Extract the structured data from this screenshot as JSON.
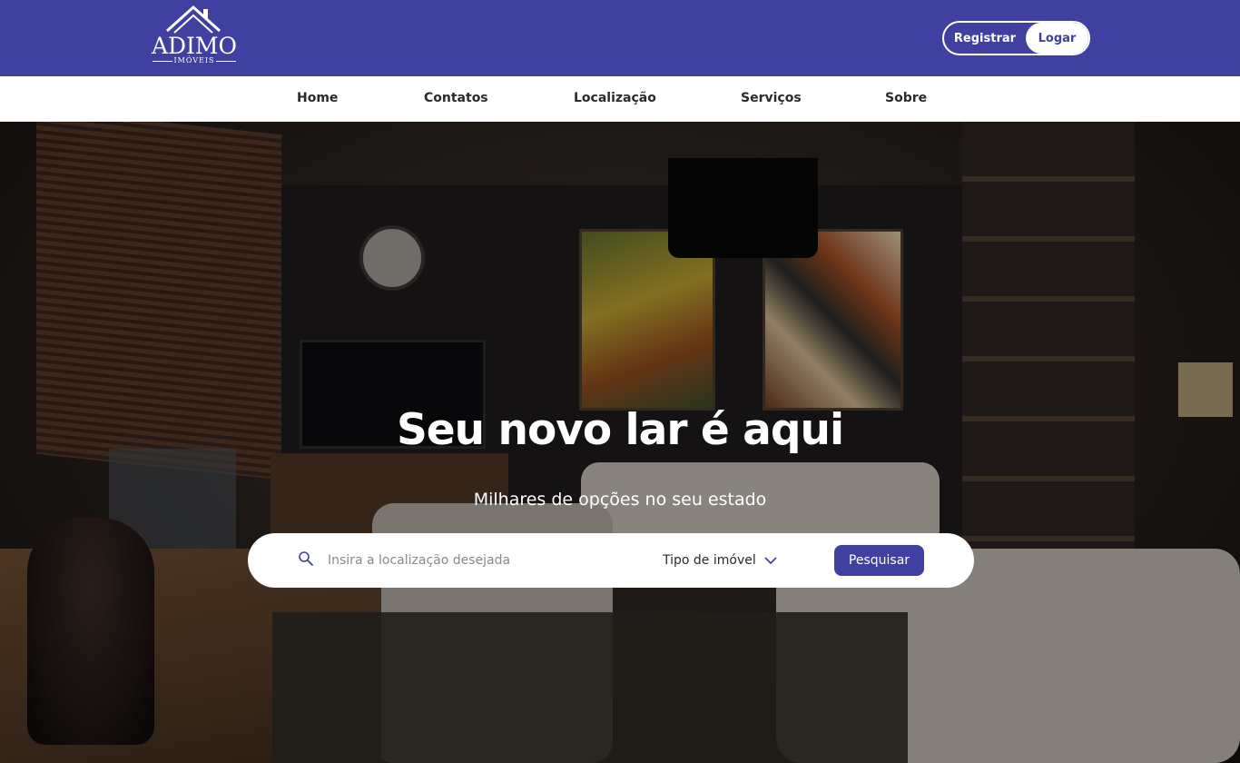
{
  "header": {
    "logo_name": "ADIMO",
    "logo_sub": "IMÓVEIS",
    "register_label": "Registrar",
    "login_label": "Logar"
  },
  "nav": {
    "items": [
      "Home",
      "Contatos",
      "Localização",
      "Serviços",
      "Sobre"
    ]
  },
  "hero": {
    "title": "Seu novo lar é aqui",
    "subtitle": "Milhares de opções no seu estado"
  },
  "search": {
    "placeholder": "Insira a localização desejada",
    "type_label": "Tipo de imóvel",
    "button_label": "Pesquisar"
  },
  "colors": {
    "brand": "#4040a0",
    "nav_bg": "#ffffff",
    "text_dark": "#2a2a2a"
  },
  "icons": {
    "logo": "house-roof-icon",
    "search": "search-icon",
    "dropdown": "chevron-down-icon"
  }
}
